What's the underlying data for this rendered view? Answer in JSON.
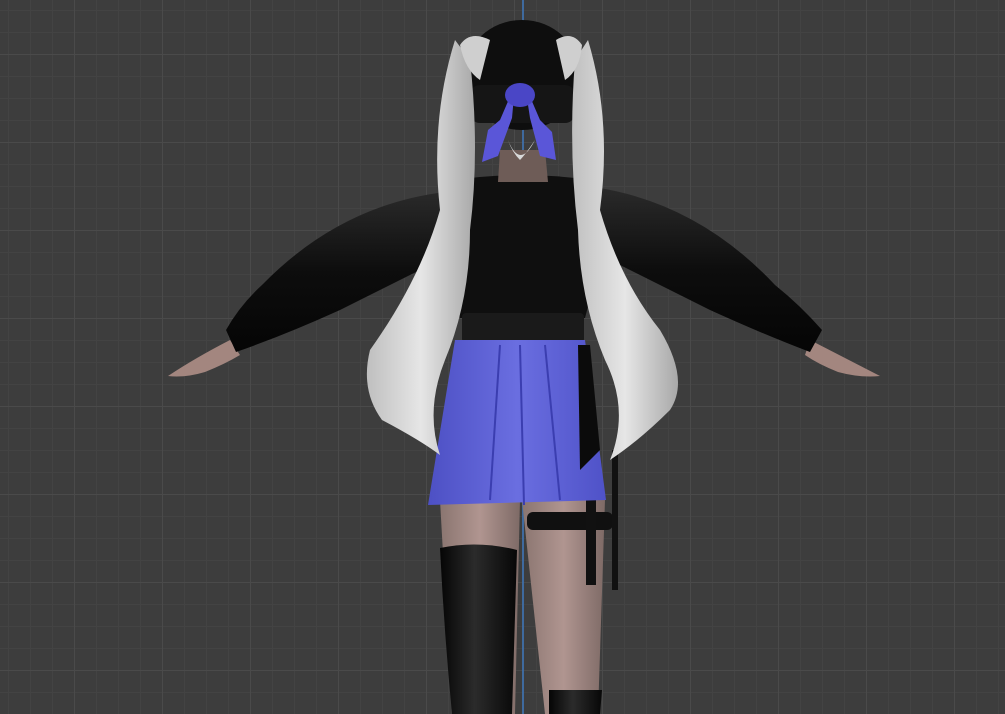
{
  "viewport": {
    "view": "back",
    "axis": "z",
    "axis_color": "#3f6fa8",
    "grid_color": "#4a4a4a",
    "background_color": "#3d3d3d"
  },
  "model": {
    "object": "character",
    "colors": {
      "jacket": "#111111",
      "skirt": "#5b5fd0",
      "ribbon": "#5a56d8",
      "hair": "#d7d7d7",
      "skin": "#a88e84",
      "stockings": "#121212",
      "belt": "#1a1a1a"
    }
  }
}
